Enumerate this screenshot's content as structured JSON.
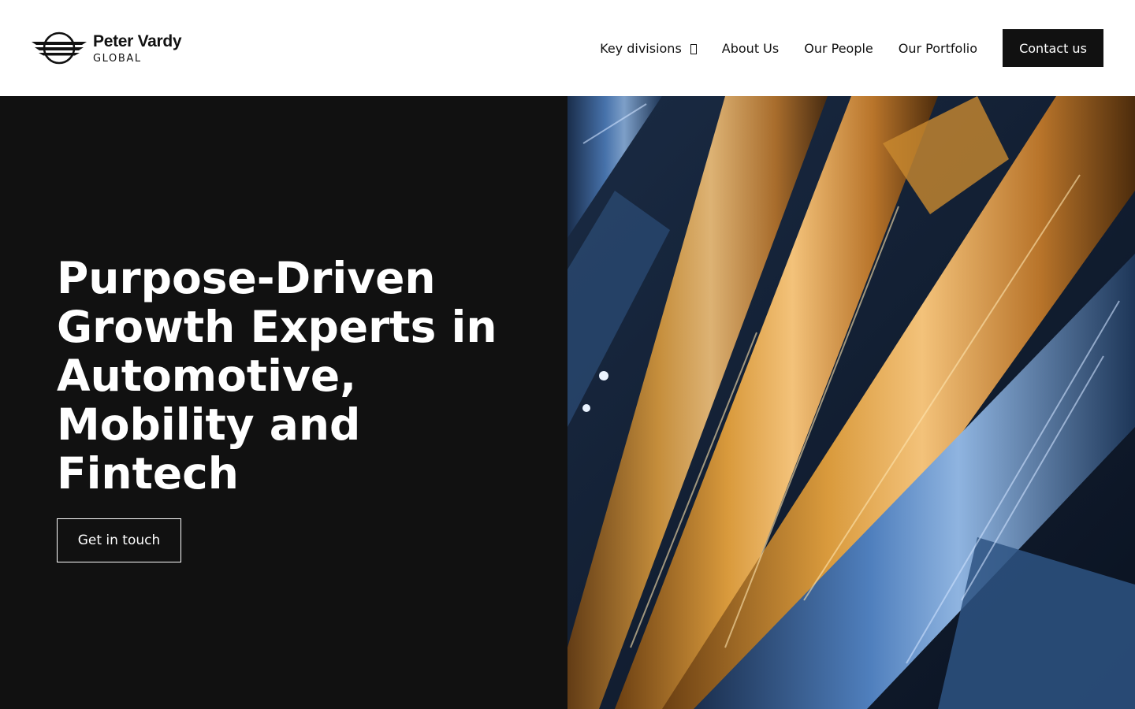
{
  "header": {
    "logo": {
      "name": "Peter Vardy",
      "sub": "GLOBAL",
      "icon": "winged-wheel-logo"
    },
    "nav": [
      {
        "label": "Key divisions",
        "has_dropdown": true,
        "icon": "chevron-down-icon"
      },
      {
        "label": "About Us"
      },
      {
        "label": "Our People"
      },
      {
        "label": "Our Portfolio"
      }
    ],
    "contact_label": "Contact us"
  },
  "hero": {
    "title": "Purpose-Driven Growth Experts in Automotive, Mobility and Fintech",
    "cta_label": "Get in touch",
    "image": "aerial-highway-interchange-night-photo"
  },
  "colors": {
    "dark": "#111111",
    "white": "#ffffff",
    "road_amber": "#c8862e",
    "road_blue": "#3f6fa8"
  }
}
